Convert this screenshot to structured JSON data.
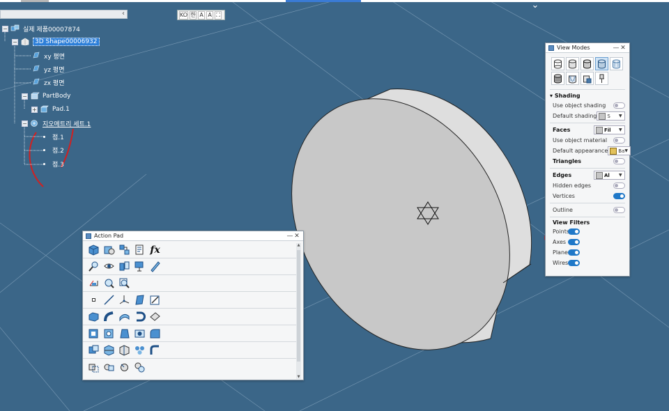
{
  "collapse_icon": "chevron-down-icon",
  "lang_bar": {
    "lang": "KO",
    "items": [
      "한",
      "A",
      "A"
    ]
  },
  "tree": {
    "items": [
      {
        "label": "실제 제품00007874",
        "icon": "product-icon"
      },
      {
        "label": "3D Shape00006932",
        "icon": "shape-icon",
        "selected": true
      },
      {
        "label": "xy 평면",
        "icon": "plane-icon"
      },
      {
        "label": "yz 평면",
        "icon": "plane-icon"
      },
      {
        "label": "zx 평면",
        "icon": "plane-icon"
      },
      {
        "label": "PartBody",
        "icon": "body-icon"
      },
      {
        "label": "Pad.1",
        "icon": "pad-icon"
      },
      {
        "label": "지오메트리 세트.1",
        "icon": "geoset-icon"
      },
      {
        "label": "점.1",
        "icon": "point-icon"
      },
      {
        "label": "점.2",
        "icon": "point-icon"
      },
      {
        "label": "점.3",
        "icon": "point-icon"
      }
    ]
  },
  "view_modes": {
    "title": "View Modes",
    "close": "✕",
    "minimize": "—",
    "shading_header": "Shading",
    "use_object_shading": "Use object shading",
    "default_shading": "Default shading",
    "default_shading_value": "S",
    "faces": "Faces",
    "faces_value": "Fil",
    "use_object_material": "Use object material",
    "default_appearance": "Default appearance",
    "default_appearance_value": "Ba",
    "triangles": "Triangles",
    "edges": "Edges",
    "edges_value": "Al",
    "hidden_edges": "Hidden edges",
    "vertices": "Vertices",
    "outline": "Outline",
    "view_filters": "View Filters",
    "points": "Points",
    "axes": "Axes",
    "planes": "Planes",
    "wires": "Wires",
    "toggles": {
      "use_object_shading": false,
      "triangles": false,
      "use_object_material": false,
      "hidden_edges": false,
      "vertices": true,
      "outline": false,
      "points": true,
      "axes": true,
      "planes": true,
      "wires": true
    }
  },
  "action_pad": {
    "title": "Action Pad",
    "close": "✕",
    "minimize": "—",
    "fx_label": "fx"
  },
  "colors": {
    "background": "#3b6688",
    "model_face": "#c8c8c8",
    "model_side": "#dedede",
    "annotation": "#d22020",
    "toggle_on": "#1f78c8"
  }
}
